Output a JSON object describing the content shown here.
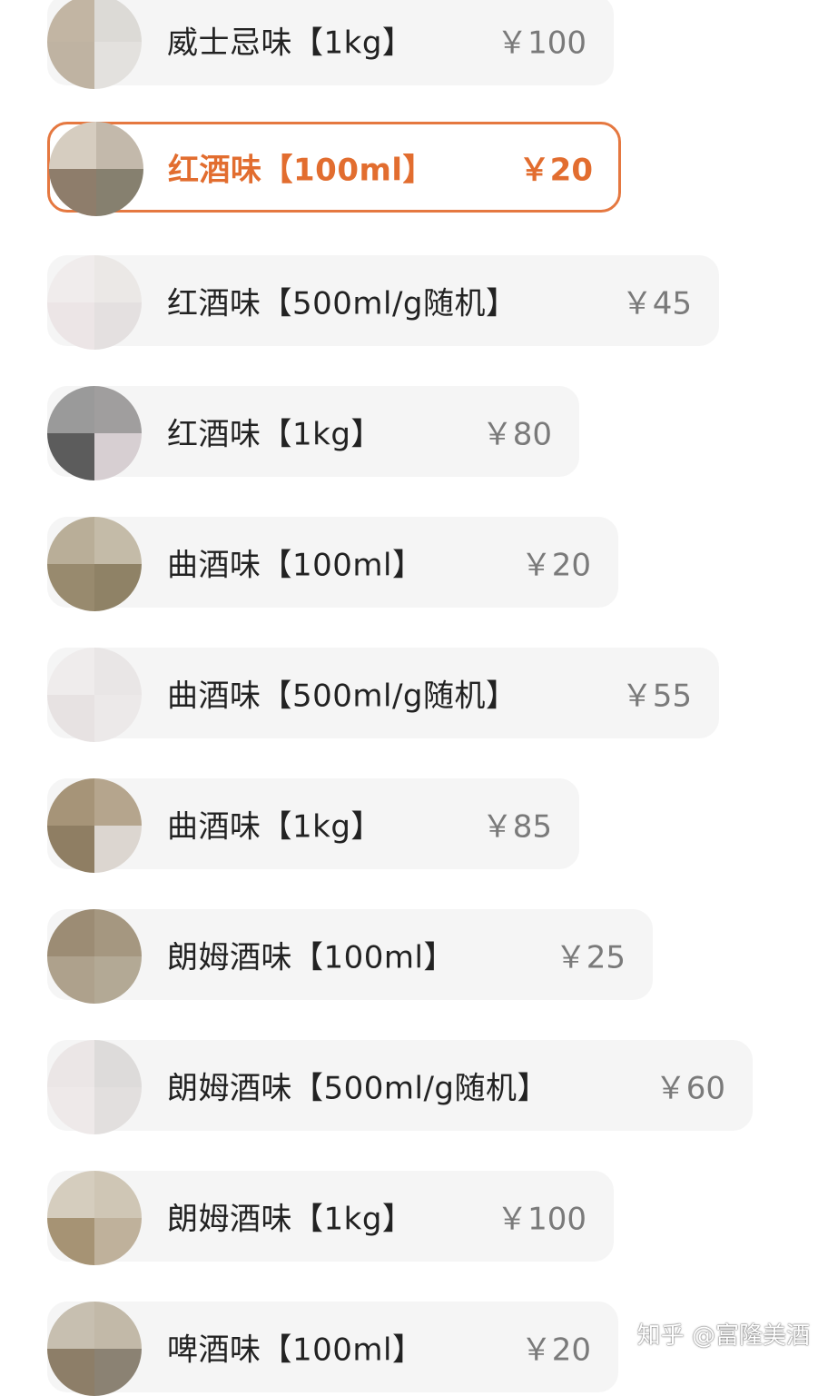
{
  "options": [
    {
      "name": "威士忌味【1kg】",
      "price": "￥100",
      "selected": false,
      "thumb_colors": [
        "#c2b5a3",
        "#dcdad6",
        "#bfb3a2",
        "#e3e1de"
      ]
    },
    {
      "name": "红酒味【100ml】",
      "price": "￥20",
      "selected": true,
      "thumb_colors": [
        "#d6cdc0",
        "#c3b9ab",
        "#8e7d6b",
        "#86806f"
      ]
    },
    {
      "name": "红酒味【500ml/g随机】",
      "price": "￥45",
      "selected": false,
      "thumb_colors": [
        "#f0ecec",
        "#ebe8e6",
        "#ece5e6",
        "#e4e0e0"
      ]
    },
    {
      "name": "红酒味【1kg】",
      "price": "￥80",
      "selected": false,
      "thumb_colors": [
        "#9a9a9a",
        "#a09e9e",
        "#5c5c5c",
        "#d7cfd2"
      ]
    },
    {
      "name": "曲酒味【100ml】",
      "price": "￥20",
      "selected": false,
      "thumb_colors": [
        "#b9ae98",
        "#c4bba8",
        "#988a6e",
        "#8f8266"
      ]
    },
    {
      "name": "曲酒味【500ml/g随机】",
      "price": "￥55",
      "selected": false,
      "thumb_colors": [
        "#efecec",
        "#e9e6e6",
        "#e7e2e2",
        "#ece9e9"
      ]
    },
    {
      "name": "曲酒味【1kg】",
      "price": "￥85",
      "selected": false,
      "thumb_colors": [
        "#a69478",
        "#b5a58d",
        "#8f7e63",
        "#dcd6d0"
      ]
    },
    {
      "name": "朗姆酒味【100ml】",
      "price": "￥25",
      "selected": false,
      "thumb_colors": [
        "#9c8c74",
        "#a59780",
        "#aea18c",
        "#b3a995"
      ]
    },
    {
      "name": "朗姆酒味【500ml/g随机】",
      "price": "￥60",
      "selected": false,
      "thumb_colors": [
        "#ebe6e6",
        "#dddbda",
        "#eee9e9",
        "#e2dfde"
      ]
    },
    {
      "name": "朗姆酒味【1kg】",
      "price": "￥100",
      "selected": false,
      "thumb_colors": [
        "#d5cdbe",
        "#cfc6b5",
        "#a69374",
        "#bfb19b"
      ]
    },
    {
      "name": "啤酒味【100ml】",
      "price": "￥20",
      "selected": false,
      "thumb_colors": [
        "#c7bfb0",
        "#c2b9a8",
        "#8d7e68",
        "#8b8273"
      ]
    }
  ],
  "watermark": "知乎 @富隆美酒"
}
